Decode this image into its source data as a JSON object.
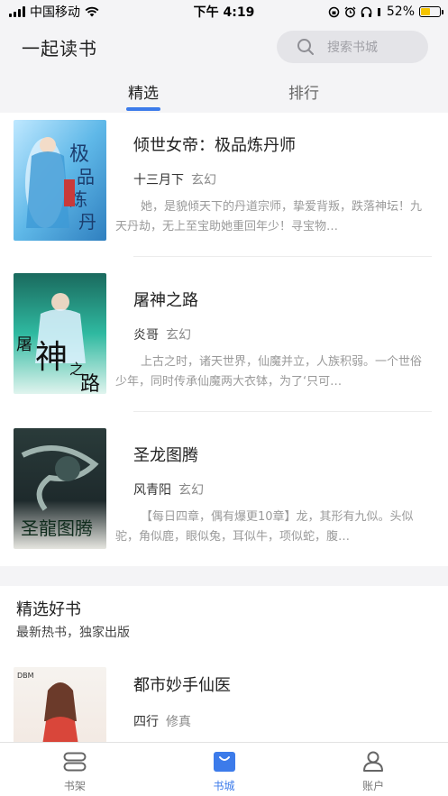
{
  "status_bar": {
    "carrier": "中国移动",
    "time": "下午 4:19",
    "battery_percent": "52%",
    "battery_level": 0.52
  },
  "header": {
    "app_title": "一起读书",
    "search_placeholder": "搜索书城"
  },
  "tabs": [
    {
      "label": "精选",
      "active": true
    },
    {
      "label": "排行",
      "active": false
    }
  ],
  "books": [
    {
      "title": "倾世女帝：极品炼丹师",
      "author": "十三月下",
      "genre": "玄幻",
      "description": "她，是貌倾天下的丹道宗师，挚爱背叛，跌落神坛！九天丹劫，无上至宝助她重回年少！寻宝物…"
    },
    {
      "title": "屠神之路",
      "author": "炎哥",
      "genre": "玄幻",
      "description": "上古之时，诸天世界，仙魔并立，人族积弱。一个世俗少年，同时传承仙魔两大衣钵，为了‘只可…"
    },
    {
      "title": "圣龙图腾",
      "author": "风青阳",
      "genre": "玄幻",
      "description": "【每日四章，偶有爆更10章】龙，其形有九似。头似驼，角似鹿，眼似兔，耳似牛，项似蛇，腹…"
    }
  ],
  "featured_section": {
    "title": "精选好书",
    "subtitle": "最新热书，独家出版",
    "book": {
      "title": "都市妙手仙医",
      "author": "四行",
      "genre": "修真"
    }
  },
  "bottom_nav": [
    {
      "label": "书架",
      "icon": "bookshelf-icon",
      "active": false
    },
    {
      "label": "书城",
      "icon": "bookstore-bag-icon",
      "active": true
    },
    {
      "label": "账户",
      "icon": "account-user-icon",
      "active": false
    }
  ],
  "colors": {
    "accent": "#3c7bea",
    "battery": "#f5c400"
  }
}
